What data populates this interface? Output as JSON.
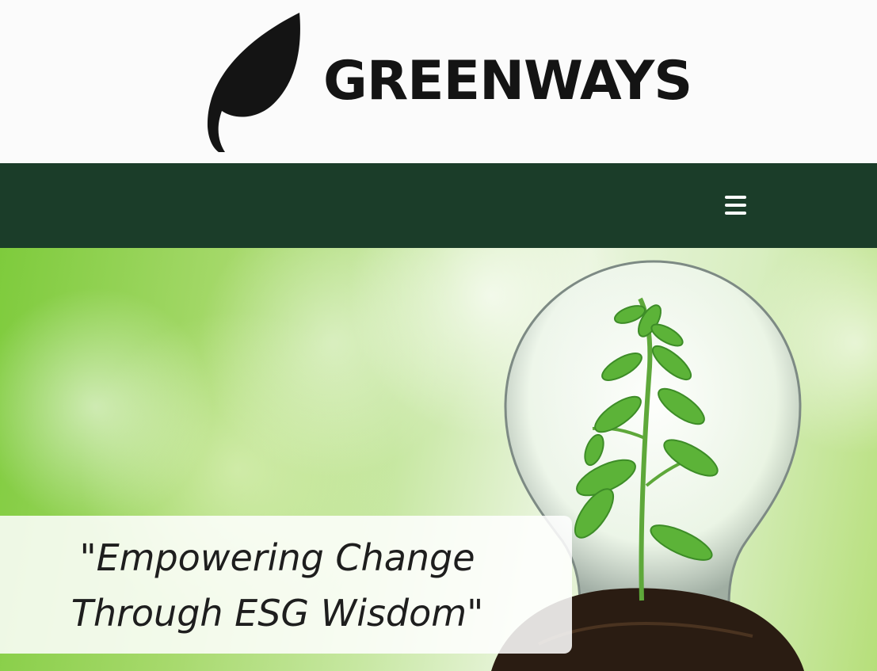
{
  "brand": {
    "name": "GREENWAYS",
    "logo_icon": "leaf-icon"
  },
  "navbar": {
    "background": "#1b3d29",
    "menu_icon": "hamburger-menu-icon"
  },
  "hero": {
    "quote": "\"Empowering Change Through ESG Wisdom\"",
    "image": "lightbulb-with-sprout"
  },
  "colors": {
    "header_bg": "#fbfbfb",
    "nav_bg": "#1b3d29",
    "text_dark": "#1e1e1e",
    "accent_green": "#7ecb3c"
  }
}
